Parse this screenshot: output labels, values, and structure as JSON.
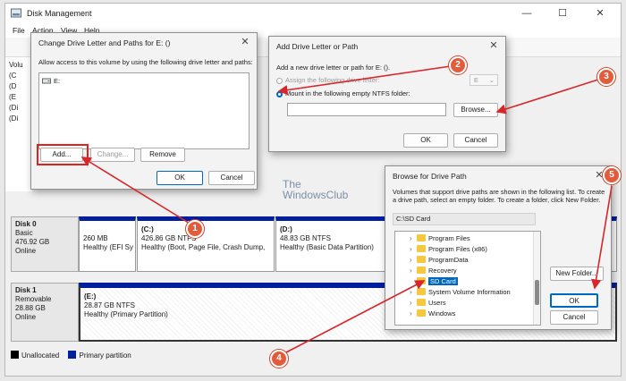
{
  "window": {
    "title": "Disk Management",
    "minimize": "—",
    "maximize": "☐",
    "close": "✕"
  },
  "menu": [
    "File",
    "Action",
    "View",
    "Help"
  ],
  "volume_list": {
    "header": "Volu",
    "rows": [
      "(C",
      "(D",
      "(E",
      "(Di",
      "(Di"
    ]
  },
  "disks": [
    {
      "name": "Disk 0",
      "type": "Basic",
      "size": "476.92 GB",
      "status": "Online",
      "partitions": [
        {
          "label": "",
          "size": "260 MB",
          "status": "Healthy (EFI Sy"
        },
        {
          "label": "(C:)",
          "size": "426.86 GB NTFS",
          "status": "Healthy (Boot, Page File, Crash Dump,"
        },
        {
          "label": "(D:)",
          "size": "48.83 GB NTFS",
          "status": "Healthy (Basic Data Partition)"
        }
      ]
    },
    {
      "name": "Disk 1",
      "type": "Removable",
      "size": "28.88 GB",
      "status": "Online",
      "partitions": [
        {
          "label": "(E:)",
          "size": "28.87 GB NTFS",
          "status": "Healthy (Primary Partition)"
        }
      ]
    }
  ],
  "legend": [
    {
      "label": "Unallocated",
      "color": "#000000"
    },
    {
      "label": "Primary partition",
      "color": "#001f9e"
    }
  ],
  "change_dialog": {
    "title": "Change Drive Letter and Paths for E: ()",
    "close": "✕",
    "instruction": "Allow access to this volume by using the following drive letter and paths:",
    "list_items": [
      "E:"
    ],
    "add": "Add...",
    "change": "Change...",
    "remove": "Remove",
    "ok": "OK",
    "cancel": "Cancel"
  },
  "add_dialog": {
    "title": "Add Drive Letter or Path",
    "close": "✕",
    "instruction": "Add a new drive letter or path for E: ().",
    "assign_label": "Assign the following drive letter:",
    "letter": "E",
    "mount_label": "Mount in the following empty NTFS folder:",
    "path_value": "",
    "browse": "Browse...",
    "ok": "OK",
    "cancel": "Cancel"
  },
  "browse_dialog": {
    "title": "Browse for Drive Path",
    "close": "✕",
    "description": "Volumes that support drive paths are shown in the following list. To create a drive path, select an empty folder. To create a folder, click New Folder.",
    "path": "C:\\SD Card",
    "tree": [
      "Program Files",
      "Program Files (x86)",
      "ProgramData",
      "Recovery",
      "SD Card",
      "System Volume Information",
      "Users",
      "Windows"
    ],
    "selected": "SD Card",
    "new_folder": "New Folder...",
    "ok": "OK",
    "cancel": "Cancel"
  },
  "watermark": {
    "line1": "The",
    "line2": "WindowsClub"
  },
  "callouts": [
    "1",
    "2",
    "3",
    "4",
    "5"
  ],
  "colors": {
    "accent": "#001f9e",
    "callout": "#e25b3b",
    "arrow": "#d8262a",
    "selection": "#0067c0"
  }
}
